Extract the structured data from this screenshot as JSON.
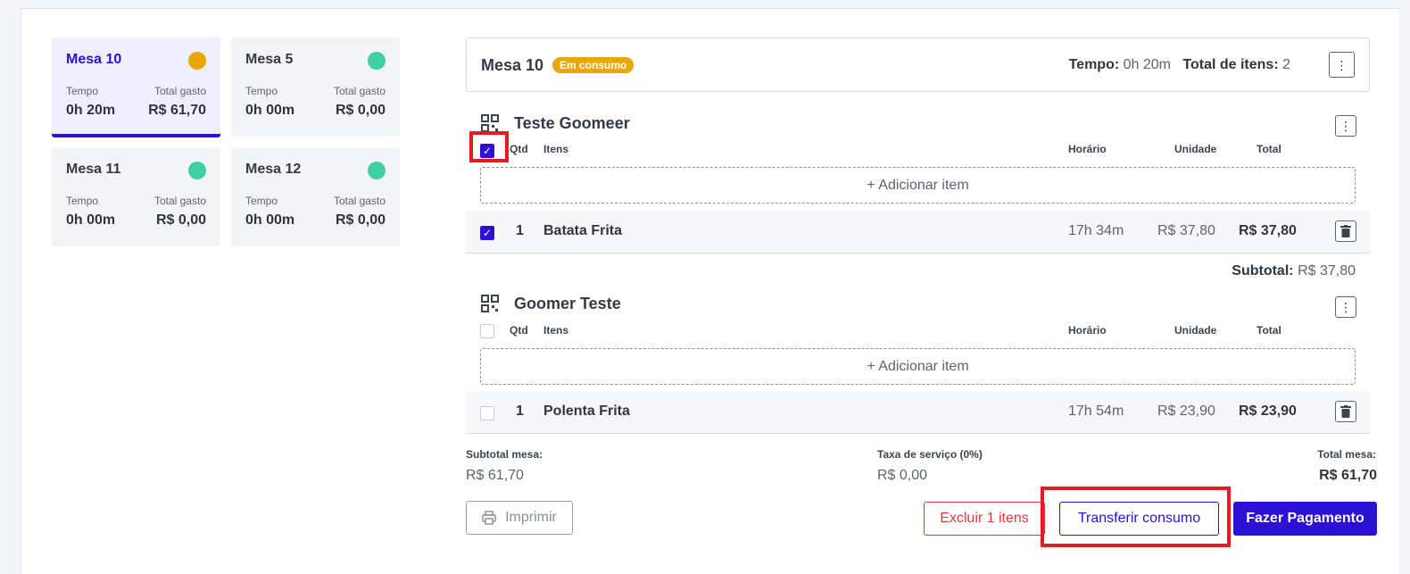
{
  "tables": [
    {
      "name": "Mesa 10",
      "time_label": "Tempo",
      "total_label": "Total gasto",
      "time": "0h 20m",
      "total": "R$ 61,70",
      "status_color": "#e8a800",
      "selected": true
    },
    {
      "name": "Mesa 5",
      "time_label": "Tempo",
      "total_label": "Total gasto",
      "time": "0h 00m",
      "total": "R$ 0,00",
      "status_color": "#3ecfa4",
      "selected": false
    },
    {
      "name": "Mesa 11",
      "time_label": "Tempo",
      "total_label": "Total gasto",
      "time": "0h 00m",
      "total": "R$ 0,00",
      "status_color": "#3ecfa4",
      "selected": false
    },
    {
      "name": "Mesa 12",
      "time_label": "Tempo",
      "total_label": "Total gasto",
      "time": "0h 00m",
      "total": "R$ 0,00",
      "status_color": "#3ecfa4",
      "selected": false
    }
  ],
  "header": {
    "title": "Mesa 10",
    "badge": "Em consumo",
    "time_label": "Tempo:",
    "time_value": "0h 20m",
    "items_label": "Total de itens:",
    "items_value": "2"
  },
  "columns": {
    "qty": "Qtd",
    "items": "Itens",
    "time": "Horário",
    "unit": "Unidade",
    "total": "Total"
  },
  "groups": [
    {
      "title": "Teste Goomeer",
      "all_checked": true,
      "add_label": "+ Adicionar item",
      "items": [
        {
          "qty": "1",
          "name": "Batata Frita",
          "time": "17h 34m",
          "unit": "R$ 37,80",
          "total": "R$ 37,80",
          "checked": true
        }
      ],
      "subtotal_label": "Subtotal:",
      "subtotal_value": "R$ 37,80"
    },
    {
      "title": "Goomer Teste",
      "all_checked": false,
      "add_label": "+ Adicionar item",
      "items": [
        {
          "qty": "1",
          "name": "Polenta Frita",
          "time": "17h 54m",
          "unit": "R$ 23,90",
          "total": "R$ 23,90",
          "checked": false
        }
      ]
    }
  ],
  "summary": {
    "subtotal_label": "Subtotal mesa:",
    "subtotal_value": "R$ 61,70",
    "service_label": "Taxa de serviço (0%)",
    "service_value": "R$ 0,00",
    "total_label": "Total mesa:",
    "total_value": "R$ 61,70"
  },
  "actions": {
    "print": "Imprimir",
    "delete": "Excluir 1 itens",
    "transfer": "Transferir consumo",
    "pay": "Fazer Pagamento"
  },
  "colors": {
    "accent": "#2b11d4",
    "danger": "#e53935",
    "highlight": "#e31b23",
    "busy": "#e8a800",
    "free": "#3ecfa4"
  }
}
